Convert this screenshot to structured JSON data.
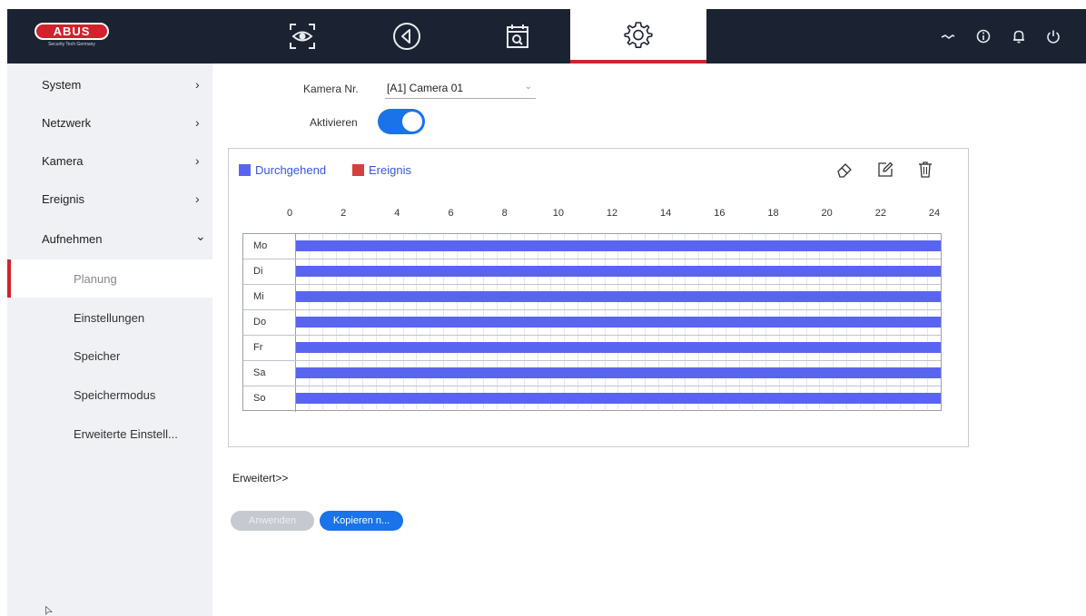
{
  "topbar": {
    "logo_text": "ABUS",
    "logo_tagline": "Security Tech Germany",
    "tabs": [
      {
        "name": "live-view-tab",
        "icon": "eye-icon",
        "active": false
      },
      {
        "name": "playback-tab",
        "icon": "play-back-icon",
        "active": false
      },
      {
        "name": "search-tab",
        "icon": "calendar-search-icon",
        "active": false
      },
      {
        "name": "settings-tab",
        "icon": "gear-icon",
        "active": true
      }
    ],
    "right_icons": [
      "network-icon",
      "info-icon",
      "bell-icon",
      "power-icon"
    ],
    "accent": "#d2222d",
    "background": "#1b2333"
  },
  "sidebar": {
    "items": [
      {
        "label": "System",
        "chevron": "›"
      },
      {
        "label": "Netzwerk",
        "chevron": "›"
      },
      {
        "label": "Kamera",
        "chevron": "›"
      },
      {
        "label": "Ereignis",
        "chevron": "›"
      },
      {
        "label": "Aufnehmen",
        "chevron": "⌄"
      }
    ],
    "subitems": [
      {
        "label": "Planung",
        "active": true
      },
      {
        "label": "Einstellungen",
        "active": false
      },
      {
        "label": "Speicher",
        "active": false
      },
      {
        "label": "Speichermodus",
        "active": false
      },
      {
        "label": "Erweiterte Einstell...",
        "active": false
      }
    ]
  },
  "form": {
    "camera_label": "Kamera Nr.",
    "camera_value": "[A1] Camera 01",
    "activate_label": "Aktivieren",
    "activate_on": true
  },
  "schedule": {
    "legend": [
      {
        "label": "Durchgehend",
        "color": "#5965f0"
      },
      {
        "label": "Ereignis",
        "color": "#d24040"
      }
    ],
    "tools": [
      "eraser-icon",
      "edit-icon",
      "trash-icon"
    ],
    "hour_labels": [
      "0",
      "2",
      "4",
      "6",
      "8",
      "10",
      "12",
      "14",
      "16",
      "18",
      "20",
      "22",
      "24"
    ],
    "days": [
      {
        "label": "Mo",
        "start": 0,
        "end": 24
      },
      {
        "label": "Di",
        "start": 0,
        "end": 24
      },
      {
        "label": "Mi",
        "start": 0,
        "end": 24
      },
      {
        "label": "Do",
        "start": 0,
        "end": 24
      },
      {
        "label": "Fr",
        "start": 0,
        "end": 24
      },
      {
        "label": "Sa",
        "start": 0,
        "end": 24
      },
      {
        "label": "So",
        "start": 0,
        "end": 24
      }
    ]
  },
  "footer": {
    "advanced_link": "Erweitert>>",
    "apply_label": "Anwenden",
    "copy_label": "Kopieren n..."
  }
}
